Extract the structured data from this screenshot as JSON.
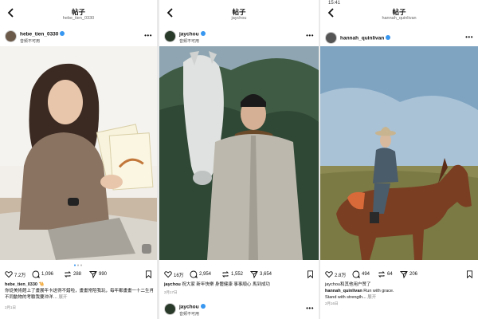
{
  "panels": [
    {
      "status_left": "",
      "header_title": "帖子",
      "header_subtitle": "hebe_tien_0330",
      "username": "hebe_tien_0330",
      "subtitle": "音频不可用",
      "likes": "7.2万",
      "comments": "1,096",
      "reposts": "288",
      "shares": "990",
      "caption_user": "hebe_tien_0330",
      "caption_text": "🐪",
      "caption_body": "你從美術館上了畫展年卡送得不錯啦，畫畫常陪我玩，每年都畫畫一十二生肖不同動物的考驗我要沖洋…",
      "caption_more": "展开",
      "date": "2月1日"
    },
    {
      "header_title": "帖子",
      "header_subtitle": "jaychou",
      "username": "jaychou",
      "subtitle": "音频不可用",
      "likes": "16万",
      "comments": "2,954",
      "reposts": "1,552",
      "shares": "3,654",
      "caption_user": "jaychou",
      "caption_text": "祝大家 新年快樂 身體健康 事事順心 馬到成功",
      "date": "2月17日",
      "next_username": "jaychou",
      "next_subtitle": "音频不可用"
    },
    {
      "status_left": "15:41",
      "header_title": "帖子",
      "header_subtitle": "hannah_quinlivan",
      "username": "hannah_quinlivan",
      "likes": "2.8万",
      "comments": "494",
      "reposts": "64",
      "shares": "206",
      "liked_by": "jaychou和其他用户赞了",
      "caption_user": "hannah_quinlivan",
      "caption_text": "Run with grace.",
      "caption_body": "Stand with strength...",
      "caption_more": "展开",
      "date": "2月16日"
    }
  ],
  "colors": {
    "verified": "#3897f0",
    "accent_dot": "#3897f0"
  },
  "icons": [
    "back-arrow-icon",
    "more-icon",
    "heart-icon",
    "comment-icon",
    "repost-icon",
    "share-icon",
    "bookmark-icon",
    "verified-icon",
    "carousel-icon"
  ]
}
